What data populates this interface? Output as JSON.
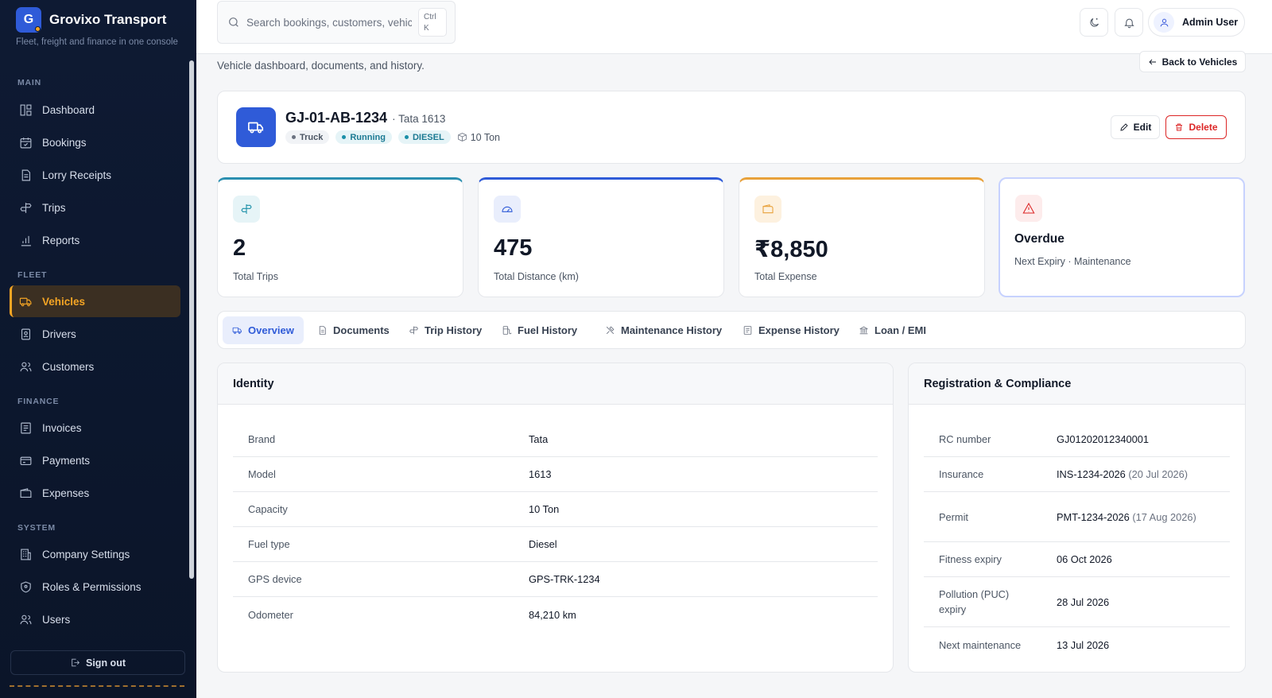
{
  "brand": {
    "logo_letter": "G",
    "name": "Grovixo Transport",
    "tagline": "Fleet, freight and finance in one console"
  },
  "sidebar": {
    "sections": {
      "main": "MAIN",
      "fleet": "FLEET",
      "finance": "FINANCE",
      "system": "SYSTEM"
    },
    "items": [
      {
        "label": "Dashboard",
        "icon": "dashboard-icon"
      },
      {
        "label": "Bookings",
        "icon": "calendar-icon"
      },
      {
        "label": "Lorry Receipts",
        "icon": "receipt-icon"
      },
      {
        "label": "Trips",
        "icon": "signpost-icon"
      },
      {
        "label": "Reports",
        "icon": "bar-chart-icon"
      },
      {
        "label": "Vehicles",
        "icon": "truck-icon"
      },
      {
        "label": "Drivers",
        "icon": "id-badge-icon"
      },
      {
        "label": "Customers",
        "icon": "users-icon"
      },
      {
        "label": "Invoices",
        "icon": "invoice-icon"
      },
      {
        "label": "Payments",
        "icon": "card-icon"
      },
      {
        "label": "Expenses",
        "icon": "wallet-icon"
      },
      {
        "label": "Company Settings",
        "icon": "building-icon"
      },
      {
        "label": "Roles & Permissions",
        "icon": "shield-icon"
      },
      {
        "label": "Users",
        "icon": "users-icon"
      }
    ],
    "active": "Vehicles",
    "sign_out": "Sign out"
  },
  "topbar": {
    "search_placeholder": "Search bookings, customers, vehicles",
    "shortcut_line1": "Ctrl",
    "shortcut_line2": "K",
    "user_name": "Admin User"
  },
  "page": {
    "subtitle": "Vehicle dashboard, documents, and history.",
    "back_label": "Back to Vehicles"
  },
  "vehicle": {
    "registration": "GJ-01-AB-1234",
    "model_line": "· Tata 1613",
    "tags": [
      "Truck",
      "Running",
      "DIESEL"
    ],
    "capacity": "10 Ton",
    "edit_label": "Edit",
    "delete_label": "Delete"
  },
  "stats": [
    {
      "value": "2",
      "label": "Total Trips"
    },
    {
      "value": "475",
      "label": "Total Distance (km)"
    },
    {
      "value": "₹8,850",
      "label": "Total Expense"
    },
    {
      "title": "Overdue",
      "label": "Next Expiry · Maintenance"
    }
  ],
  "tabs": [
    "Overview",
    "Documents",
    "Trip History",
    "Fuel History",
    "Maintenance History",
    "Expense History",
    "Loan / EMI"
  ],
  "identity": {
    "title": "Identity",
    "rows": [
      {
        "k": "Brand",
        "v": "Tata"
      },
      {
        "k": "Model",
        "v": "1613"
      },
      {
        "k": "Capacity",
        "v": "10 Ton"
      },
      {
        "k": "Fuel type",
        "v": "Diesel"
      },
      {
        "k": "GPS device",
        "v": "GPS-TRK-1234"
      },
      {
        "k": "Odometer",
        "v": "84,210 km"
      }
    ]
  },
  "compliance": {
    "title": "Registration & Compliance",
    "rows": [
      {
        "k": "RC number",
        "v": "GJ01202012340001",
        "d": ""
      },
      {
        "k": "Insurance",
        "v": "INS-1234-2026",
        "d": "(20 Jul 2026)"
      },
      {
        "k": "Permit",
        "v": "PMT-1234-2026",
        "d": "(17 Aug 2026)"
      },
      {
        "k": "Fitness expiry",
        "v": "06 Oct 2026",
        "d": ""
      },
      {
        "k": "Pollution (PUC) expiry",
        "v": "28 Jul 2026",
        "d": ""
      },
      {
        "k": "Next maintenance",
        "v": "13 Jul 2026",
        "d": ""
      }
    ]
  },
  "colors": {
    "accent": "#2f5bd8",
    "active_nav": "#f5a524",
    "danger": "#dc2626",
    "sidebar_bg": "#0e1a33"
  }
}
